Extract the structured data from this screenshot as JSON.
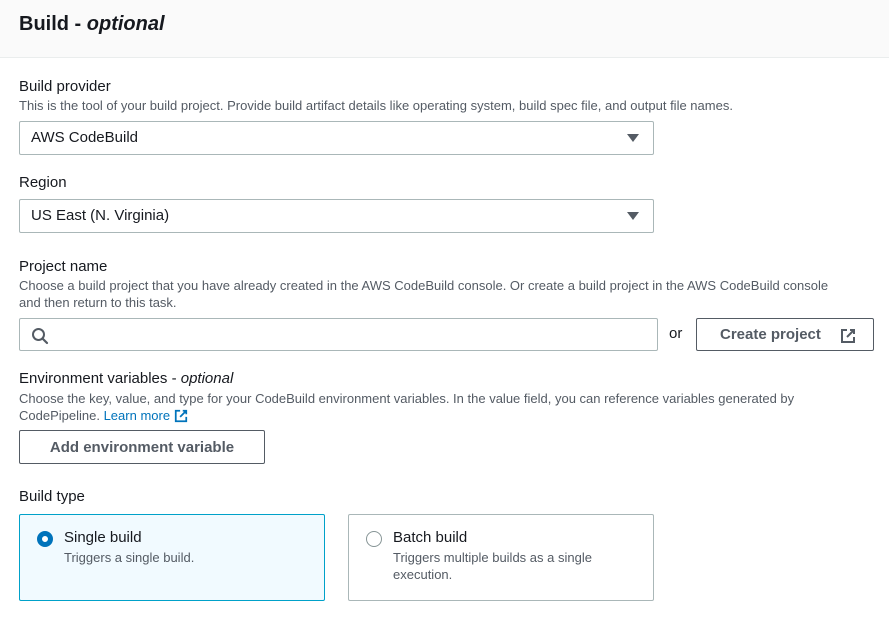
{
  "header": {
    "title": "Build - ",
    "title_optional": "optional"
  },
  "build_provider": {
    "label": "Build provider",
    "description": "This is the tool of your build project. Provide build artifact details like operating system, build spec file, and output file names.",
    "value": "AWS CodeBuild"
  },
  "region": {
    "label": "Region",
    "value": "US East (N. Virginia)"
  },
  "project_name": {
    "label": "Project name",
    "description_line1": "Choose a build project that you have already created in the AWS CodeBuild console. Or create a build project in the AWS CodeBuild console",
    "description_line2": "and then return to this task.",
    "search_value": "",
    "or_text": "or",
    "create_button": "Create project"
  },
  "environment_variables": {
    "label": "Environment variables - ",
    "label_optional": "optional",
    "description_line1": "Choose the key, value, and type for your CodeBuild environment variables. In the value field, you can reference variables generated by",
    "description_line2": "CodePipeline.",
    "learn_more": "Learn more",
    "add_button": "Add environment variable"
  },
  "build_type": {
    "label": "Build type",
    "options": [
      {
        "title": "Single build",
        "description": "Triggers a single build.",
        "selected": true
      },
      {
        "title": "Batch build",
        "description": "Triggers multiple builds as a single execution.",
        "selected": false
      }
    ]
  },
  "colors": {
    "accent": "#0073bb",
    "selected_tile_bg": "#f1faff",
    "selected_tile_border": "#00a1c9",
    "text": "#16191f",
    "secondary_text": "#545b64"
  }
}
